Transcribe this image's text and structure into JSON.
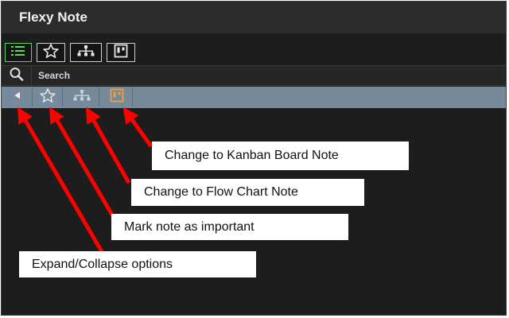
{
  "app": {
    "title": "Flexy Note"
  },
  "toolbar": {
    "buttons": [
      {
        "icon": "list-icon"
      },
      {
        "icon": "star-icon"
      },
      {
        "icon": "flowchart-icon"
      },
      {
        "icon": "kanban-icon"
      }
    ]
  },
  "search": {
    "label": "Search",
    "icon": "search-icon"
  },
  "options": {
    "buttons": [
      {
        "icon": "collapse-arrow-icon"
      },
      {
        "icon": "star-icon"
      },
      {
        "icon": "flowchart-icon"
      },
      {
        "icon": "kanban-icon"
      }
    ]
  },
  "annotations": {
    "kanban": "Change to Kanban Board Note",
    "flowchart": "Change to Flow Chart Note",
    "important": "Mark note as important",
    "expand": "Expand/Collapse options"
  },
  "colors": {
    "background": "#1d1d1d",
    "options_bar": "#778a9b",
    "list_icon": "#5fd35f",
    "kanban_icon": "#e8a23a",
    "arrow": "#ff0000"
  }
}
